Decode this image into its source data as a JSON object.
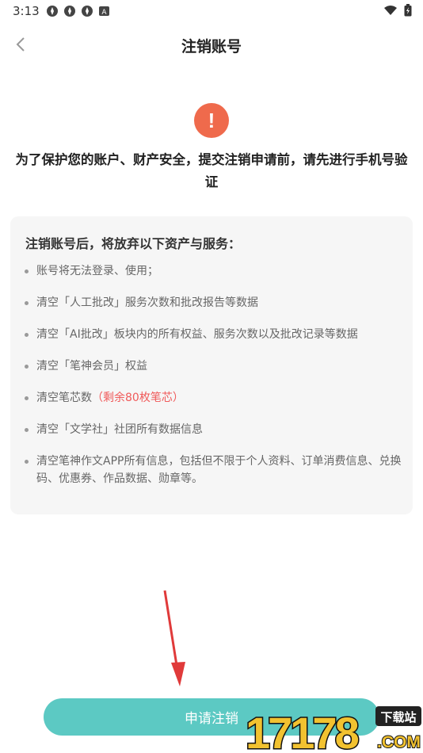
{
  "status_bar": {
    "time": "3:13",
    "notif_badge": "A"
  },
  "nav": {
    "title": "注销账号"
  },
  "warning": {
    "icon": "exclamation-circle-icon",
    "color": "#ef6a4c",
    "symbol": "!",
    "text": "为了保护您的账户、财产安全，提交注销申请前，请先进行手机号验证"
  },
  "card": {
    "title": "注销账号后，将放弃以下资产与服务：",
    "items": [
      {
        "text": "账号将无法登录、使用；"
      },
      {
        "text": "清空「人工批改」服务次数和批改报告等数据"
      },
      {
        "text": "清空「AI批改」板块内的所有权益、服务次数以及批改记录等数据"
      },
      {
        "text": "清空「笔神会员」权益"
      },
      {
        "text": "清空笔芯数",
        "highlight": "（剩余80枚笔芯）"
      },
      {
        "text": "清空「文学社」社团所有数据信息"
      },
      {
        "text": "清空笔神作文APP所有信息，包括但不限于个人资料、订单消费信息、兑换码、优惠券、作品数据、勋章等。"
      }
    ]
  },
  "submit": {
    "label": "申请注销",
    "color": "#5cc9c3"
  },
  "watermark": {
    "number": "17178",
    "badge": "下载站",
    "domain": ".COM"
  },
  "annotation": {
    "arrow_color": "#e03a3a"
  }
}
